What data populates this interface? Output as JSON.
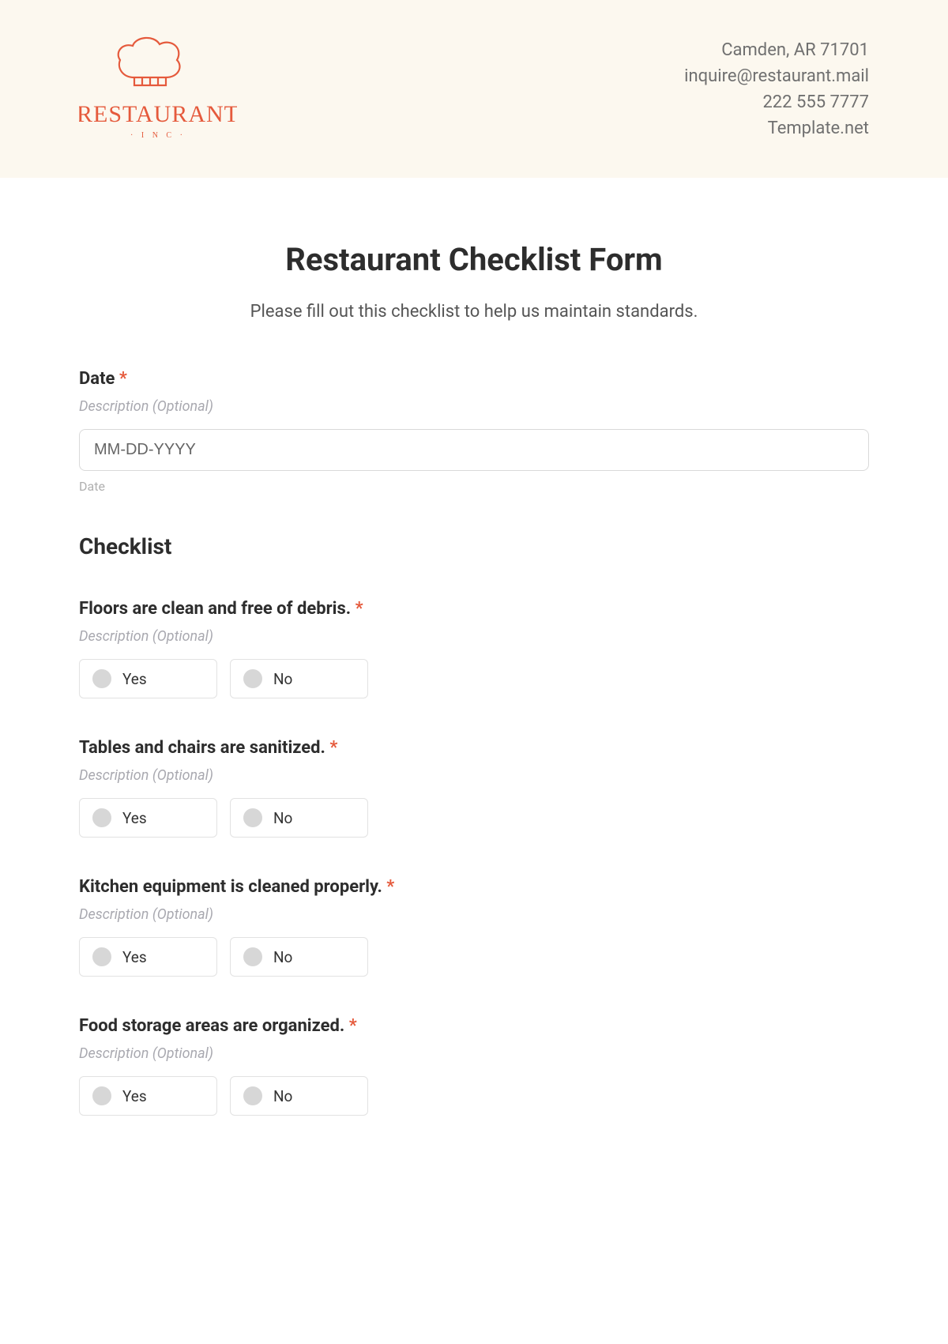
{
  "header": {
    "logo_main": "RESTAURANT",
    "logo_sub": "· I N C ·",
    "contact": {
      "address": "Camden, AR 71701",
      "email": "inquire@restaurant.mail",
      "phone": "222 555 7777",
      "site": "Template.net"
    }
  },
  "form": {
    "title": "Restaurant Checklist Form",
    "subtitle": "Please fill out this checklist to help us maintain standards.",
    "required_mark": "*",
    "desc_text": "Description (Optional)",
    "date": {
      "label": "Date",
      "placeholder": "MM-DD-YYYY",
      "sublabel": "Date"
    },
    "checklist_heading": "Checklist",
    "options": {
      "yes": "Yes",
      "no": "No"
    },
    "items": [
      {
        "label": "Floors are clean and free of debris."
      },
      {
        "label": "Tables and chairs are sanitized."
      },
      {
        "label": "Kitchen equipment is cleaned properly."
      },
      {
        "label": "Food storage areas are organized."
      }
    ]
  }
}
